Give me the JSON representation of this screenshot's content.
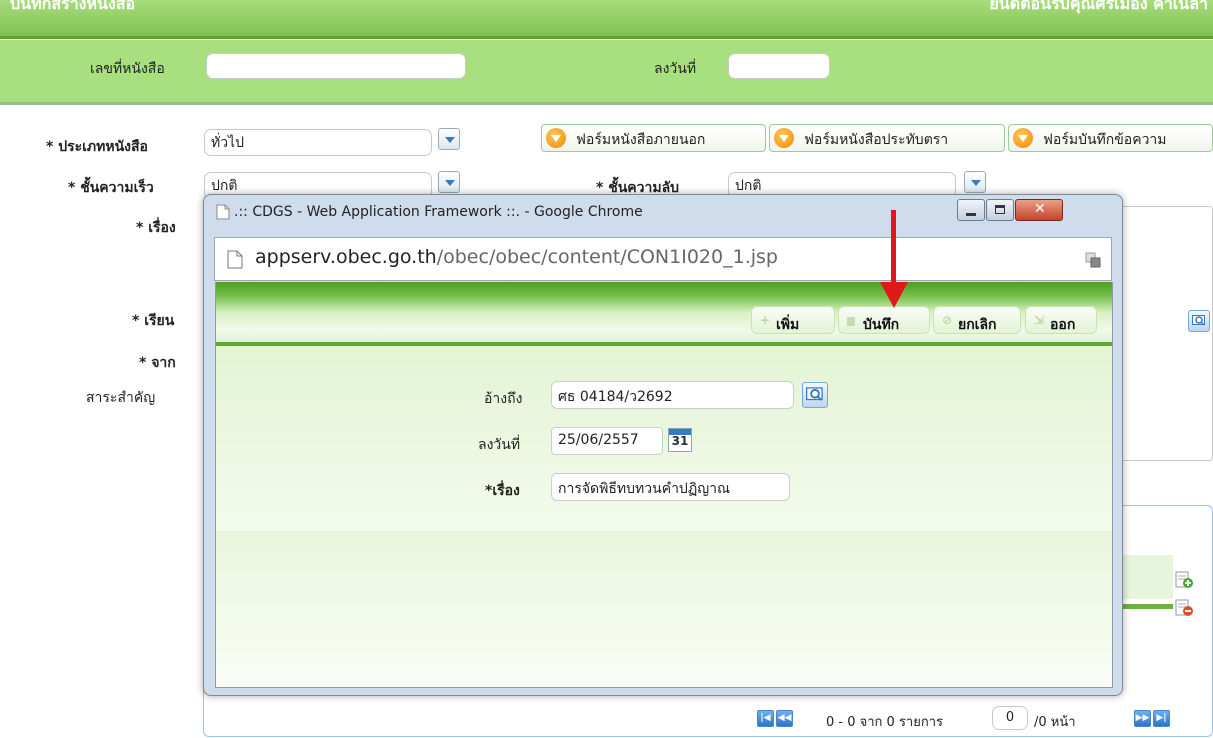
{
  "header": {
    "title": "บันทึกสร้างหนังสือ",
    "user": "ยินดีต้อนรับคุณศรีเมือง คำเนลา"
  },
  "top_fields": {
    "doc_no_label": "เลขที่หนังสือ",
    "doc_no_value": "",
    "date_label": "ลงวันที่",
    "date_value": ""
  },
  "form": {
    "type_label": "* ประเภทหนังสือ",
    "type_value": "ทั่วไป",
    "speed_label": "* ชั้นความเร็ว",
    "speed_value": "ปกติ",
    "secret_label": "* ชั้นความลับ",
    "secret_value": "ปกติ",
    "subject_label": "* เรื่อง",
    "to_label": "* เรียน",
    "from_label": "* จาก",
    "summary_label": "สาระสำคัญ"
  },
  "form_buttons": [
    {
      "label": "ฟอร์มหนังสือภายนอก"
    },
    {
      "label": "ฟอร์มหนังสือประทับตรา"
    },
    {
      "label": "ฟอร์มบันทึกข้อความ"
    }
  ],
  "popup": {
    "title": ".:: CDGS - Web Application Framework ::. - Google Chrome",
    "url_domain": "appserv.obec.go.th",
    "url_path": "/obec/obec/content/CON1I020_1.jsp",
    "toolbar": {
      "add": "เพิ่ม",
      "save": "บันทึก",
      "cancel": "ยกเลิก",
      "exit": "ออก"
    },
    "ref_label": "อ้างถึง",
    "ref_value": "ศธ 04184/ว2692",
    "date_label": "ลงวันที่",
    "date_value": "25/06/2557",
    "calendar_day": "31",
    "subject_label": "*เรื่อง",
    "subject_value": "การจัดพิธีทบทวนคำปฏิญาณ"
  },
  "pager": {
    "summary": "0 - 0 จาก 0 รายการ",
    "page_value": "0",
    "page_total": "/0 หน้า"
  },
  "colors": {
    "header_green": "#7fc24f",
    "band_green": "#a8e080",
    "arrow_red": "#e01818"
  }
}
